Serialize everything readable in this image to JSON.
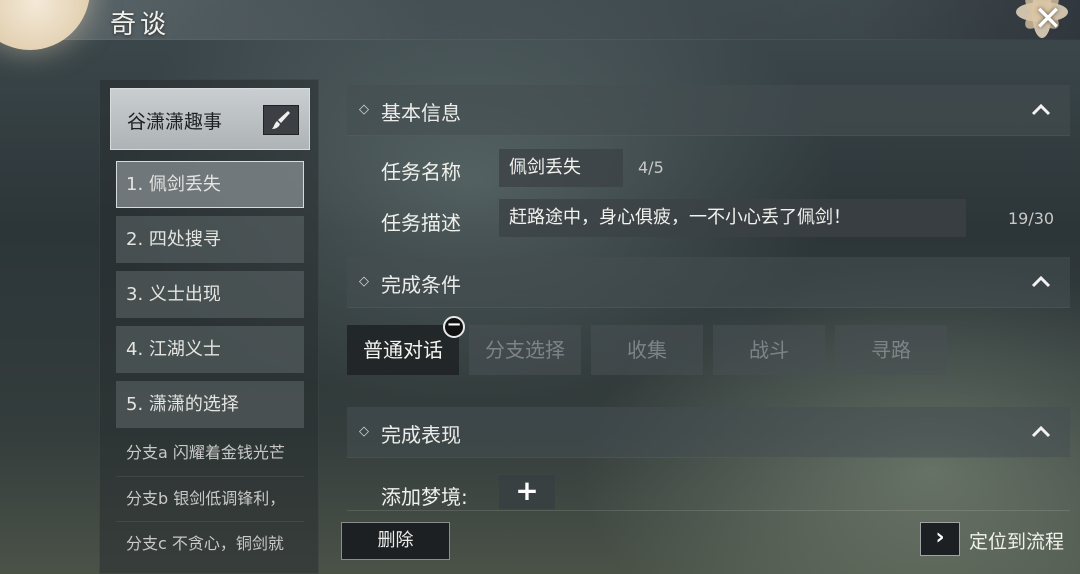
{
  "window": {
    "title": "奇谈",
    "close_glyph": "✕"
  },
  "sidebar": {
    "story_title": "谷潇潇趣事",
    "items": [
      {
        "label": "1. 佩剑丢失"
      },
      {
        "label": "2. 四处搜寻"
      },
      {
        "label": "3. 义士出现"
      },
      {
        "label": "4. 江湖义士"
      },
      {
        "label": "5. 潇潇的选择"
      }
    ],
    "selected_index": 0,
    "branches": [
      {
        "label": "分支a 闪耀着金钱光芒"
      },
      {
        "label": "分支b 银剑低调锋利，"
      },
      {
        "label": "分支c 不贪心，铜剑就"
      }
    ]
  },
  "basic_info": {
    "section_title": "基本信息",
    "task_name_label": "任务名称",
    "task_name_value": "佩剑丢失",
    "task_name_count": "4/5",
    "task_desc_label": "任务描述",
    "task_desc_value": "赶路途中，身心俱疲，一不小心丢了佩剑！",
    "task_desc_count": "19/30"
  },
  "conditions": {
    "section_title": "完成条件",
    "types": [
      {
        "label": "普通对话"
      },
      {
        "label": "分支选择"
      },
      {
        "label": "收集"
      },
      {
        "label": "战斗"
      },
      {
        "label": "寻路"
      }
    ],
    "active_index": 0
  },
  "performance": {
    "section_title": "完成表现",
    "add_dream_label": "添加梦境:",
    "add_glyph": "+"
  },
  "footer": {
    "delete_label": "删除",
    "locate_label": "定位到流程",
    "locate_glyph": "›"
  },
  "colors": {
    "accent_light": "#c9ced0",
    "active_button": "#1e2224",
    "text": "#e8e8e6"
  }
}
